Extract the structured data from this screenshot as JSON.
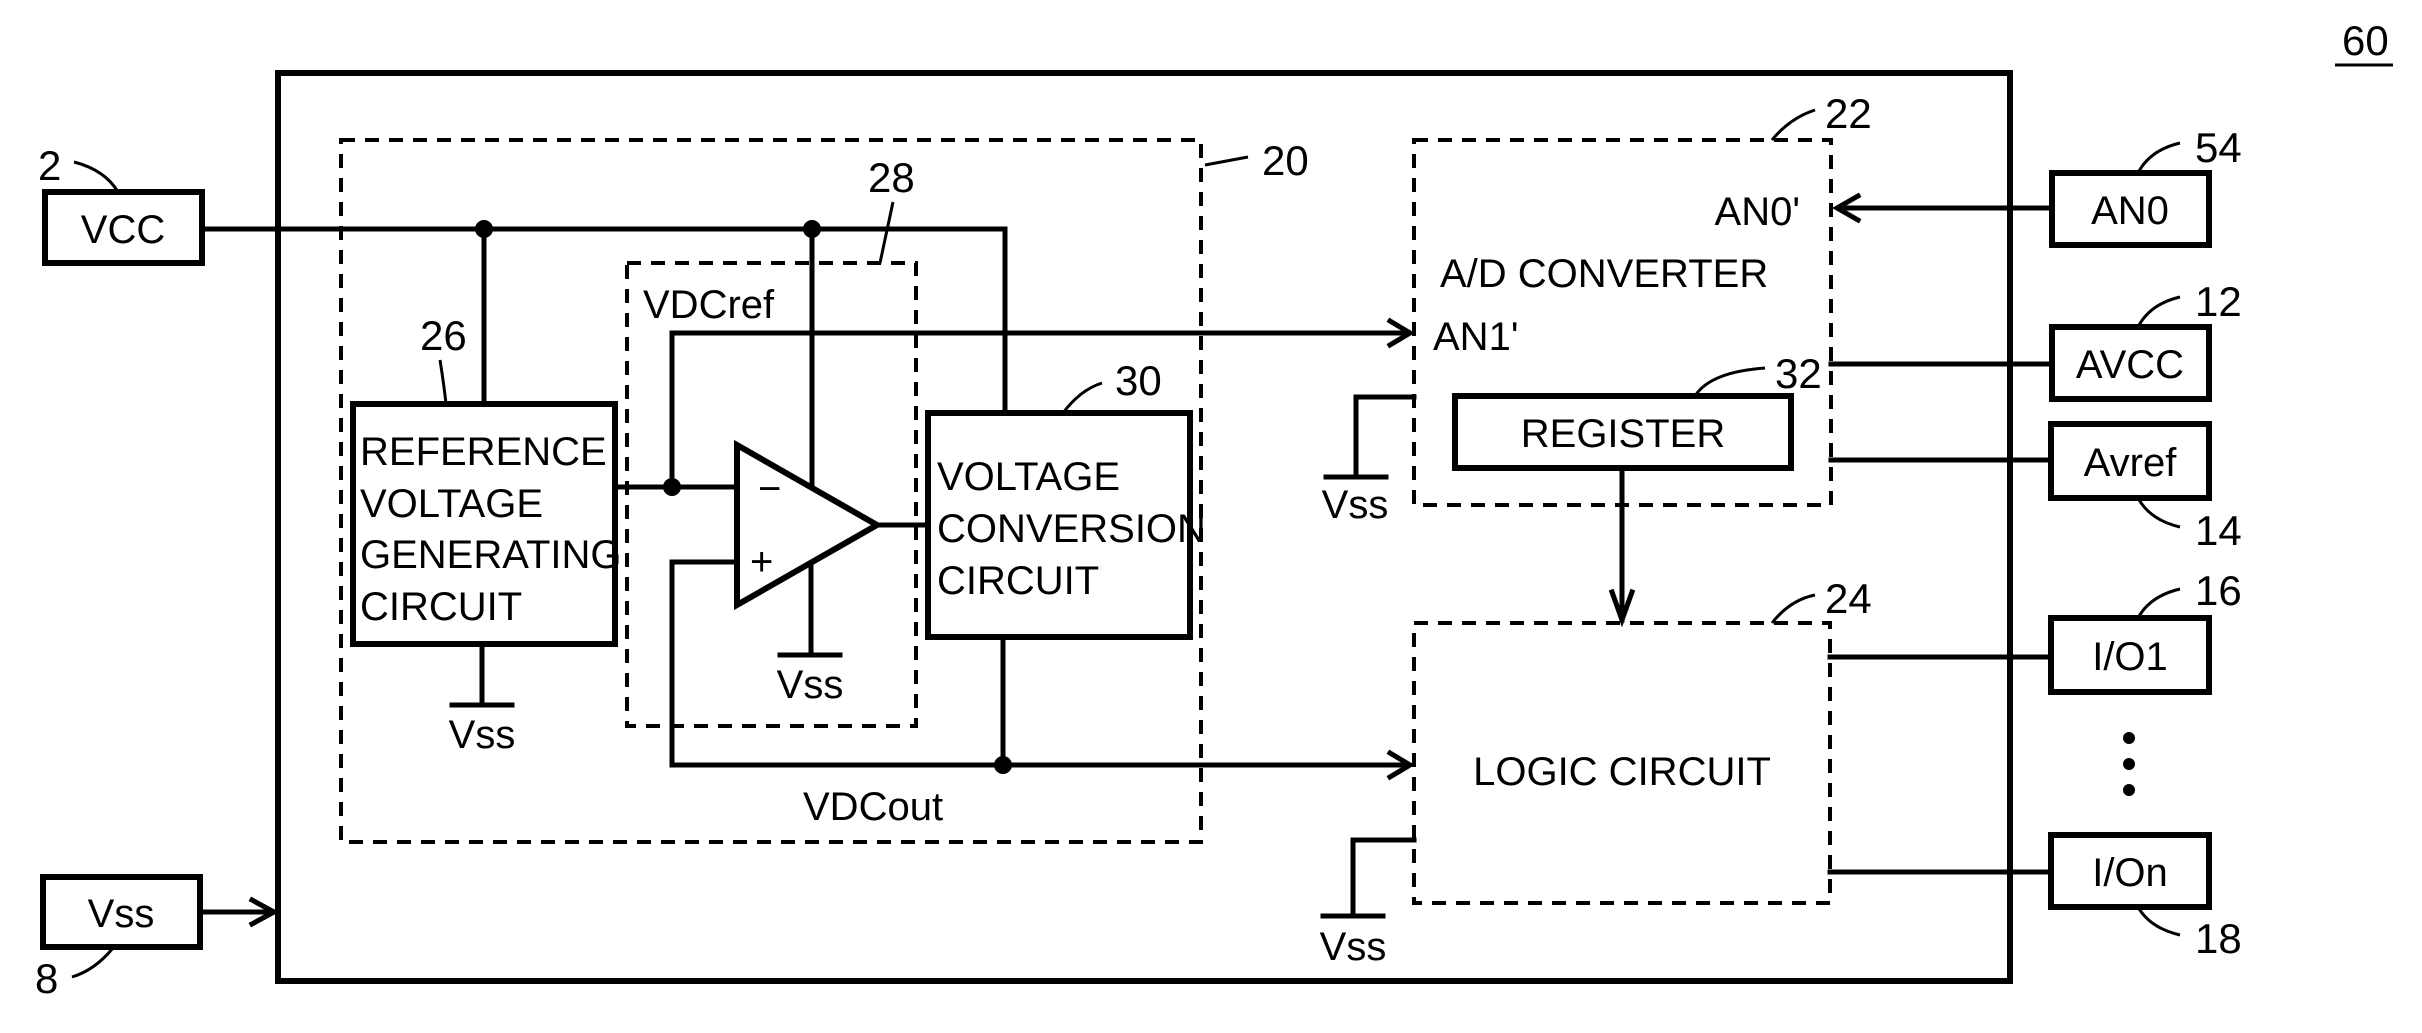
{
  "figure": {
    "ref_number": "60",
    "pins": {
      "vcc": {
        "label": "VCC",
        "ref": "2"
      },
      "vss": {
        "label": "Vss",
        "ref": "8"
      },
      "an0": {
        "label": "AN0",
        "ref": "54"
      },
      "avcc": {
        "label": "AVCC",
        "ref": "12"
      },
      "avref": {
        "label": "Avref",
        "ref": "14"
      },
      "io1": {
        "label": "I/O1",
        "ref": "16"
      },
      "ion": {
        "label": "I/On",
        "ref": "18"
      }
    },
    "blocks": {
      "power_block": {
        "ref": "20"
      },
      "ad_converter": {
        "ref": "22",
        "title": "A/D CONVERTER",
        "input0": "AN0'",
        "input1": "AN1'"
      },
      "logic_circuit": {
        "ref": "24",
        "title": "LOGIC CIRCUIT"
      },
      "reference_circuit": {
        "ref": "26",
        "lines": [
          "REFERENCE",
          "VOLTAGE",
          "GENERATING",
          "CIRCUIT"
        ]
      },
      "comparator_block": {
        "ref": "28",
        "signal": "VDCref"
      },
      "conversion_circuit": {
        "ref": "30",
        "lines": [
          "VOLTAGE",
          "CONVERSION",
          "CIRCUIT"
        ]
      },
      "register": {
        "ref": "32",
        "title": "REGISTER"
      }
    },
    "opamp": {
      "minus": "−",
      "plus": "+"
    },
    "ground_label": "Vss",
    "output_signal": "VDCout"
  }
}
